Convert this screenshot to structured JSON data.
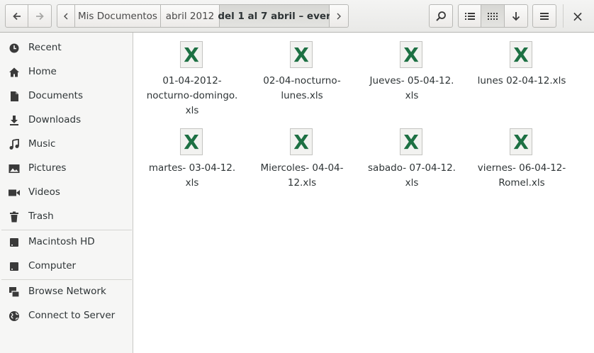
{
  "toolbar": {
    "back": "back-arrow",
    "forward": "forward-arrow",
    "breadcrumbs": [
      "Mis Documentos",
      "abril  2012",
      "del 1 al 7 abril – ever"
    ],
    "search": "search-icon",
    "list_view": "list-icon",
    "grid_view": "grid-icon",
    "sort": "sort-down-icon",
    "menu": "menu-icon",
    "close": "×"
  },
  "sidebar": {
    "items": [
      {
        "label": "Recent",
        "icon": "clock-icon"
      },
      {
        "label": "Home",
        "icon": "home-icon"
      },
      {
        "label": "Documents",
        "icon": "document-icon"
      },
      {
        "label": "Downloads",
        "icon": "download-icon"
      },
      {
        "label": "Music",
        "icon": "music-icon"
      },
      {
        "label": "Pictures",
        "icon": "picture-icon"
      },
      {
        "label": "Videos",
        "icon": "video-icon"
      },
      {
        "label": "Trash",
        "icon": "trash-icon"
      },
      {
        "label": "Macintosh HD",
        "icon": "drive-icon"
      },
      {
        "label": "Computer",
        "icon": "drive-icon"
      },
      {
        "label": "Browse Network",
        "icon": "network-icon"
      },
      {
        "label": "Connect to Server",
        "icon": "globe-icon"
      }
    ]
  },
  "files": [
    {
      "name": "01-04-2012-\nnocturno-domingo.\nxls",
      "icon_letter": "X"
    },
    {
      "name": "02-04-nocturno-\nlunes.xls",
      "icon_letter": "X"
    },
    {
      "name": "Jueves- 05-04-12.\nxls",
      "icon_letter": "X"
    },
    {
      "name": "lunes 02-04-12.xls",
      "icon_letter": "X"
    },
    {
      "name": "martes- 03-04-12.\nxls",
      "icon_letter": "X"
    },
    {
      "name": "Miercoles- 04-04-\n12.xls",
      "icon_letter": "X"
    },
    {
      "name": "sabado- 07-04-12.\nxls",
      "icon_letter": "X"
    },
    {
      "name": "viernes- 06-04-12-\nRomel.xls",
      "icon_letter": "X"
    }
  ],
  "colors": {
    "excel_green": "#1d7043"
  }
}
